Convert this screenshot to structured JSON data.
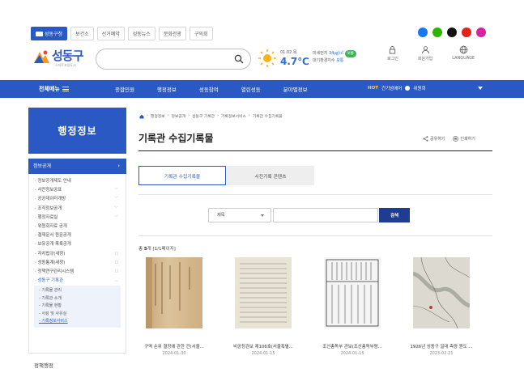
{
  "top": {
    "tabs": [
      "성동구청",
      "보건소",
      "선거예약",
      "성동뉴스",
      "문화관광",
      "구의회"
    ],
    "sns": [
      {
        "name": "facebook-icon",
        "color": "#1877f2"
      },
      {
        "name": "blog-icon",
        "color": "#2db400"
      },
      {
        "name": "x-icon",
        "color": "#111111"
      },
      {
        "name": "youtube-icon",
        "color": "#e62117"
      },
      {
        "name": "instagram-icon",
        "color": "#d6249f"
      }
    ]
  },
  "header": {
    "logo_text": "성동구",
    "logo_sub": "스마트포용도시",
    "weather": {
      "date": "01.02.목",
      "temp": "4.7℃",
      "dust_label": "미세먼지",
      "dust_value": "34㎍/㎥",
      "dust_status": "보통",
      "air_label": "대기환경지수",
      "air_value": "보통"
    },
    "util": [
      "로그인",
      "회원가입",
      "LANGUAGE"
    ]
  },
  "gnb": {
    "menu_all": "전체메뉴",
    "items": [
      "종합민원",
      "행정정보",
      "성동참여",
      "열린성동",
      "분야별정보"
    ],
    "hot_label": "HOT",
    "hot_text": "건기념에어",
    "hot_sub": "위원회"
  },
  "sidebar": {
    "hero": "행정정보",
    "section": "정보공개",
    "items": [
      {
        "label": "정보공개제도 안내",
        "mark": ""
      },
      {
        "label": "사전정보공표",
        "mark": "﹀"
      },
      {
        "label": "공공데이터개방",
        "mark": "﹀"
      },
      {
        "label": "조직정보공개",
        "mark": "﹀"
      },
      {
        "label": "행정자료실",
        "mark": "﹀"
      },
      {
        "label": "위원회자료 공개",
        "mark": ""
      },
      {
        "label": "결재문서 원문공개",
        "mark": ""
      },
      {
        "label": "보유공개 목록공개",
        "mark": ""
      },
      {
        "label": "자치법규(새창)",
        "mark": "☐"
      },
      {
        "label": "성동통계(새창)",
        "mark": "☐"
      },
      {
        "label": "정책연구관리시스템",
        "mark": "☐"
      },
      {
        "label": "성동구 기록관",
        "mark": "︿"
      }
    ],
    "sub_items": [
      "기록물 관리",
      "기록관 소개",
      "기록물 현황",
      "서킹 및 사유실",
      "기록정보서비스"
    ],
    "bottom": "정책행정"
  },
  "content": {
    "breadcrumb": [
      "행정정보",
      "정보공개",
      "성동구 기록관",
      "기록정보서비스",
      "기록관 수집기록물"
    ],
    "title": "기록관 수집기록물",
    "actions": [
      "공유하기",
      "인쇄하기"
    ],
    "tabs": [
      "기록관 수집기록물",
      "시진기록 콘텐츠"
    ],
    "search": {
      "select": "제목",
      "button": "검색"
    },
    "count_prefix": "총",
    "count_num": "5",
    "count_suffix": "개 [1/1페이지]",
    "cards": [
      {
        "caption": "구역 순위 결정에 관한 건(서울...",
        "date": "2024-01-30"
      },
      {
        "caption": "비공정관보 제106호(서울특별...",
        "date": "2024-01-15"
      },
      {
        "caption": "조선총독부 관보(조선총독부령...",
        "date": "2024-01-15"
      },
      {
        "caption": "1926년 성동구 일대 측량 원도 ...",
        "date": "2023-02-21"
      }
    ]
  }
}
